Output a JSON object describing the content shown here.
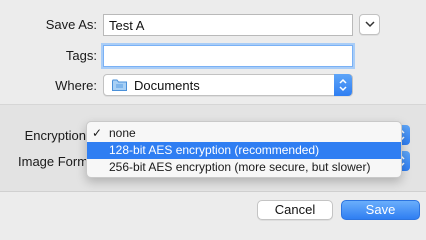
{
  "save_as": {
    "label": "Save As:",
    "value": "Test A"
  },
  "tags": {
    "label": "Tags:",
    "value": ""
  },
  "where": {
    "label": "Where:",
    "value": "Documents"
  },
  "encryption": {
    "label": "Encryption",
    "options": [
      {
        "label": "none",
        "checked": true,
        "highlighted": false
      },
      {
        "label": "128-bit AES encryption (recommended)",
        "checked": false,
        "highlighted": true
      },
      {
        "label": "256-bit AES encryption (more secure, but slower)",
        "checked": false,
        "highlighted": false
      }
    ]
  },
  "image_format": {
    "label": "Image Forma"
  },
  "buttons": {
    "cancel": "Cancel",
    "save": "Save"
  },
  "icons": {
    "expand": "chevron-down-icon",
    "folder": "folder-icon",
    "stepper": "updown-arrows-icon",
    "check": "checkmark-icon"
  },
  "colors": {
    "accent": "#2f7ef2",
    "focus_ring": "#a9cdf7"
  }
}
